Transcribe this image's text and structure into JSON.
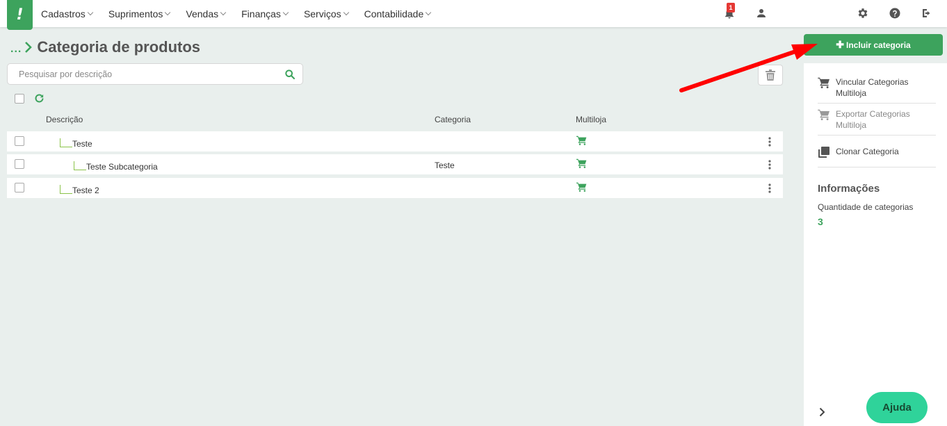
{
  "app": {
    "logo_mark": "!"
  },
  "nav": {
    "items": [
      {
        "label": "Cadastros"
      },
      {
        "label": "Suprimentos"
      },
      {
        "label": "Vendas"
      },
      {
        "label": "Finanças"
      },
      {
        "label": "Serviços"
      },
      {
        "label": "Contabilidade"
      }
    ],
    "notification_count": "1"
  },
  "page": {
    "breadcrumb_ellipsis": "...",
    "title": "Categoria de produtos"
  },
  "search": {
    "placeholder": "Pesquisar por descrição"
  },
  "table": {
    "headers": {
      "description": "Descrição",
      "category": "Categoria",
      "multistore": "Multiloja"
    },
    "rows": [
      {
        "description": "Teste",
        "category": "",
        "level": 1
      },
      {
        "description": "Teste Subcategoria",
        "category": "Teste",
        "level": 2
      },
      {
        "description": "Teste 2",
        "category": "",
        "level": 1
      }
    ]
  },
  "side": {
    "add_button": "Incluir categoria",
    "actions": [
      {
        "label": "Vincular Categorias Multiloja",
        "enabled": true
      },
      {
        "label": "Exportar Categorias Multiloja",
        "enabled": false
      },
      {
        "label": "Clonar Categoria",
        "enabled": true
      }
    ],
    "info_title": "Informações",
    "count_label": "Quantidade de categorias",
    "count_value": "3"
  },
  "help_button": "Ajuda",
  "colors": {
    "brand": "#3da35d",
    "help": "#2fd39a",
    "badge": "#e53935",
    "annotation_arrow": "#ff0000"
  }
}
